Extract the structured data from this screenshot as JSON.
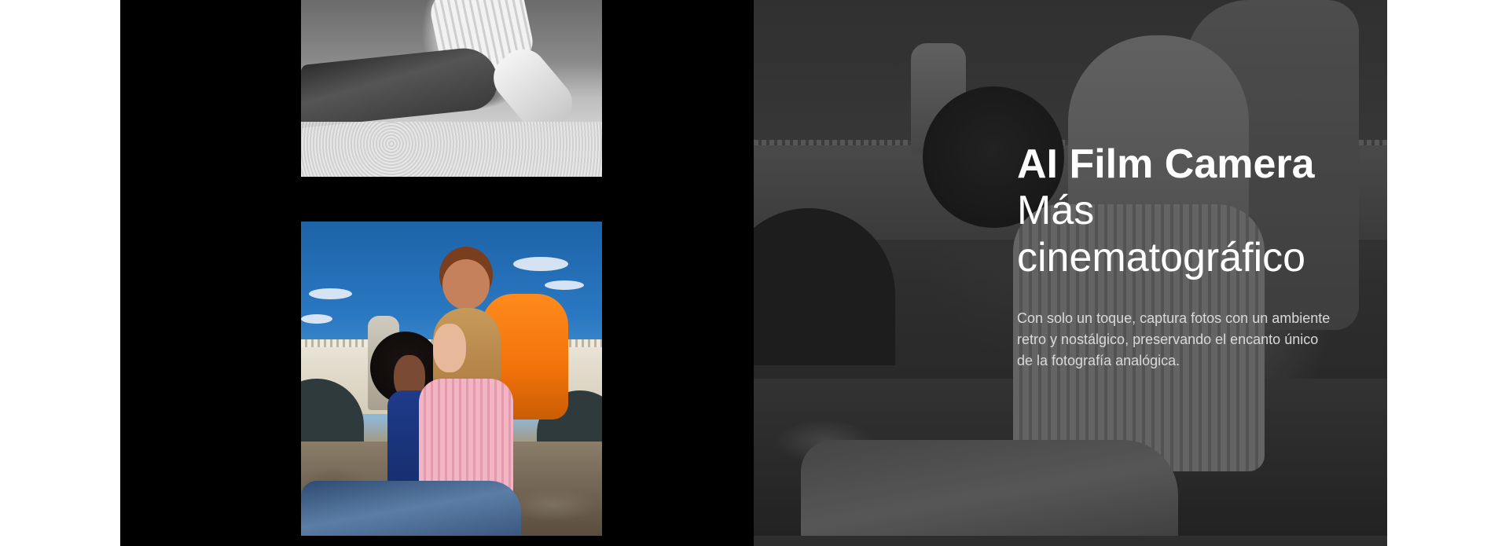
{
  "hero": {
    "title": "AI Film Camera",
    "subtitle_line1": "Más",
    "subtitle_line2": "cinematográfico",
    "description": "Con solo un toque, captura fotos con un ambiente retro y nostálgico, preservando el encanto único de la fotografía analógica."
  },
  "colors": {
    "stage_background": "#000000",
    "page_background": "#ffffff",
    "text_primary": "#ffffff",
    "text_secondary": "#d9d9d9"
  },
  "images": [
    {
      "name": "photo-bw-crop",
      "style": "black-and-white"
    },
    {
      "name": "photo-color",
      "style": "color"
    },
    {
      "name": "hero-photo",
      "style": "monochrome-dimmed"
    }
  ]
}
